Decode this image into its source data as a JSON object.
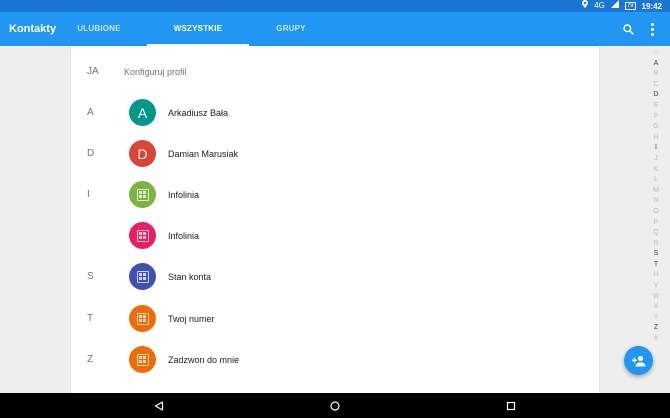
{
  "status_bar": {
    "network": "4G",
    "battery": "79",
    "time": "19:42"
  },
  "app_bar": {
    "title": "Kontakty",
    "tabs": [
      {
        "label": "ULUBIONE",
        "active": false
      },
      {
        "label": "WSZYSTKIE",
        "active": true
      },
      {
        "label": "GRUPY",
        "active": false
      }
    ],
    "icons": [
      "search-icon",
      "more-vert-icon"
    ]
  },
  "profile": {
    "section": "JA",
    "label": "Konfiguruj profil"
  },
  "contacts": [
    {
      "section": "A",
      "initial": "A",
      "name": "Arkadiusz Bała",
      "color": "#009688",
      "avatar": "letter"
    },
    {
      "section": "D",
      "initial": "D",
      "name": "Damian Marusiak",
      "color": "#db4437",
      "avatar": "letter"
    },
    {
      "section": "I",
      "initial": "",
      "name": "Infolinia",
      "color": "#7cb342",
      "avatar": "business-icon"
    },
    {
      "section": "",
      "initial": "",
      "name": "Infolinia",
      "color": "#e91e63",
      "avatar": "business-icon"
    },
    {
      "section": "S",
      "initial": "",
      "name": "Stan konta",
      "color": "#3f51b5",
      "avatar": "business-icon"
    },
    {
      "section": "T",
      "initial": "",
      "name": "Twoj numer",
      "color": "#ef6c00",
      "avatar": "business-icon"
    },
    {
      "section": "Z",
      "initial": "",
      "name": "Zadzwon do mnie",
      "color": "#ef6c00",
      "avatar": "business-icon"
    }
  ],
  "alphabet": [
    "☆",
    "A",
    "B",
    "C",
    "D",
    "E",
    "F",
    "G",
    "H",
    "I",
    "J",
    "K",
    "L",
    "M",
    "N",
    "O",
    "P",
    "Q",
    "R",
    "S",
    "T",
    "U",
    "V",
    "W",
    "X",
    "Y",
    "Z",
    "#"
  ],
  "alphabet_active": [
    "A",
    "D",
    "I",
    "S",
    "T",
    "Z"
  ],
  "fab": {
    "icon": "add-contact-icon",
    "color": "#2196f3"
  },
  "nav_bar": [
    "back-icon",
    "home-icon",
    "recents-icon"
  ]
}
